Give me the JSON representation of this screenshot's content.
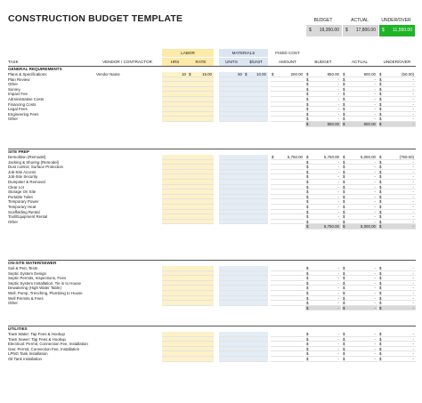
{
  "title": "CONSTRUCTION BUDGET TEMPLATE",
  "summary": {
    "budget_label": "BUDGET",
    "actual_label": "ACTUAL",
    "under_over_label": "UNDER/OVER",
    "budget": "19,350.00",
    "actual": "17,800.00",
    "under_over": "11,550.00",
    "currency": "$"
  },
  "groups": {
    "labor": "LABOR",
    "materials": "MATERIALS",
    "fixed_cost": "FIXED COST"
  },
  "columns": {
    "task": "TASK",
    "vendor": "VENDOR / CONTRACTOR",
    "hrs": "HRS",
    "rate": "RATE",
    "units": "UNITS",
    "per_unit": "$/UNIT",
    "amount": "AMOUNT",
    "budget": "BUDGET",
    "actual": "ACTUAL",
    "under_over": "UNDER/OVER"
  },
  "sections": [
    {
      "name": "GENERAL REQUIREMENTS",
      "rows": [
        {
          "task": "Plans & Specifications",
          "vendor": "Vendor Name",
          "hrs": "10",
          "rate": "15.00",
          "units": "50",
          "per_unit": "10.00",
          "amount": "200.00",
          "budget": "850.00",
          "actual": "800.00",
          "under_over": "(50.00)"
        },
        {
          "task": "Plan Review",
          "budget": "-",
          "actual": "-",
          "under_over": "-"
        },
        {
          "task": "Other",
          "budget": "-",
          "actual": "-",
          "under_over": "-"
        },
        {
          "task": "Survey",
          "budget": "-",
          "actual": "-",
          "under_over": "-"
        },
        {
          "task": "Impact Fee",
          "budget": "-",
          "actual": "-",
          "under_over": "-"
        },
        {
          "task": "Administrative Costs",
          "budget": "-",
          "actual": "-",
          "under_over": "-"
        },
        {
          "task": "Financing Costs",
          "budget": "-",
          "actual": "-",
          "under_over": "-"
        },
        {
          "task": "Legal Fees",
          "budget": "-",
          "actual": "-",
          "under_over": "-"
        },
        {
          "task": "Engineering Fees",
          "budget": "-",
          "actual": "-",
          "under_over": "-"
        },
        {
          "task": "Other",
          "budget": "-",
          "actual": "-",
          "under_over": "-"
        }
      ],
      "total": {
        "budget": "850.00",
        "actual": "800.00",
        "under_over": "-"
      }
    },
    {
      "name": "SITE PREP",
      "rows": [
        {
          "task": "Demolition (Remodel)",
          "amount": "5,750.00",
          "budget": "5,750.00",
          "actual": "5,000.00",
          "under_over": "(750.00)"
        },
        {
          "task": "Jacking & Shoring (Remodel)",
          "budget": "-",
          "actual": "-",
          "under_over": "-"
        },
        {
          "task": "Dust control, Surface Protection",
          "budget": "-",
          "actual": "-",
          "under_over": "-"
        },
        {
          "task": "Job-Site Access",
          "budget": "-",
          "actual": "-",
          "under_over": "-"
        },
        {
          "task": "Job-Site Security",
          "budget": "-",
          "actual": "-",
          "under_over": "-"
        },
        {
          "task": "Dumpster & Removal",
          "budget": "-",
          "actual": "-",
          "under_over": "-"
        },
        {
          "task": "Clear Lot",
          "budget": "-",
          "actual": "-",
          "under_over": "-"
        },
        {
          "task": "Storage On Site",
          "budget": "-",
          "actual": "-",
          "under_over": "-"
        },
        {
          "task": "Portable Toilet",
          "budget": "-",
          "actual": "-",
          "under_over": "-"
        },
        {
          "task": "Temporary Power",
          "budget": "-",
          "actual": "-",
          "under_over": "-"
        },
        {
          "task": "Temporary Heat",
          "budget": "-",
          "actual": "-",
          "under_over": "-"
        },
        {
          "task": "Scaffolding Rental",
          "budget": "-",
          "actual": "-",
          "under_over": "-"
        },
        {
          "task": "Tool/Equipment Rental",
          "budget": "-",
          "actual": "-",
          "under_over": "-"
        },
        {
          "task": "Other",
          "budget": "-",
          "actual": "-",
          "under_over": "-"
        }
      ],
      "total": {
        "budget": "5,750.00",
        "actual": "5,000.00",
        "under_over": "-"
      }
    },
    {
      "name": "ON-SITE WATER/SEWER",
      "rows": [
        {
          "task": "Soil & Perc Tests",
          "budget": "-",
          "actual": "-",
          "under_over": "-"
        },
        {
          "task": "Septic System Design",
          "budget": "-",
          "actual": "-",
          "under_over": "-"
        },
        {
          "task": "Septic Permits, Inspections, Fees",
          "budget": "-",
          "actual": "-",
          "under_over": "-"
        },
        {
          "task": "Septic System Installation, Tie in to House",
          "budget": "-",
          "actual": "-",
          "under_over": "-"
        },
        {
          "task": "Dewatering (High Water Table)",
          "budget": "-",
          "actual": "-",
          "under_over": "-"
        },
        {
          "task": "Well, Pump, Trenching, Plumbing to House",
          "budget": "-",
          "actual": "-",
          "under_over": "-"
        },
        {
          "task": "Well Permits & Fees",
          "budget": "-",
          "actual": "-",
          "under_over": "-"
        },
        {
          "task": "Other",
          "budget": "-",
          "actual": "-",
          "under_over": "-"
        }
      ],
      "total": {
        "budget": "-",
        "actual": "-",
        "under_over": "-"
      }
    },
    {
      "name": "UTILITIES",
      "rows": [
        {
          "task": "Town Water: Tap Fees & Hookup",
          "budget": "-",
          "actual": "-",
          "under_over": "-"
        },
        {
          "task": "Town Sewer: Tap Fees & Hookup",
          "budget": "-",
          "actual": "-",
          "under_over": "-"
        },
        {
          "task": "Electrical: Permit, Connection Fee, Installation",
          "budget": "-",
          "actual": "-",
          "under_over": "-"
        },
        {
          "task": "Gas: Permit, Connection Fee, Installation",
          "budget": "-",
          "actual": "-",
          "under_over": "-"
        },
        {
          "task": "LPNG Tank Installation",
          "budget": "-",
          "actual": "-",
          "under_over": "-"
        },
        {
          "task": "Oil Tank Installation",
          "budget": "-",
          "actual": "-",
          "under_over": "-"
        }
      ]
    }
  ]
}
